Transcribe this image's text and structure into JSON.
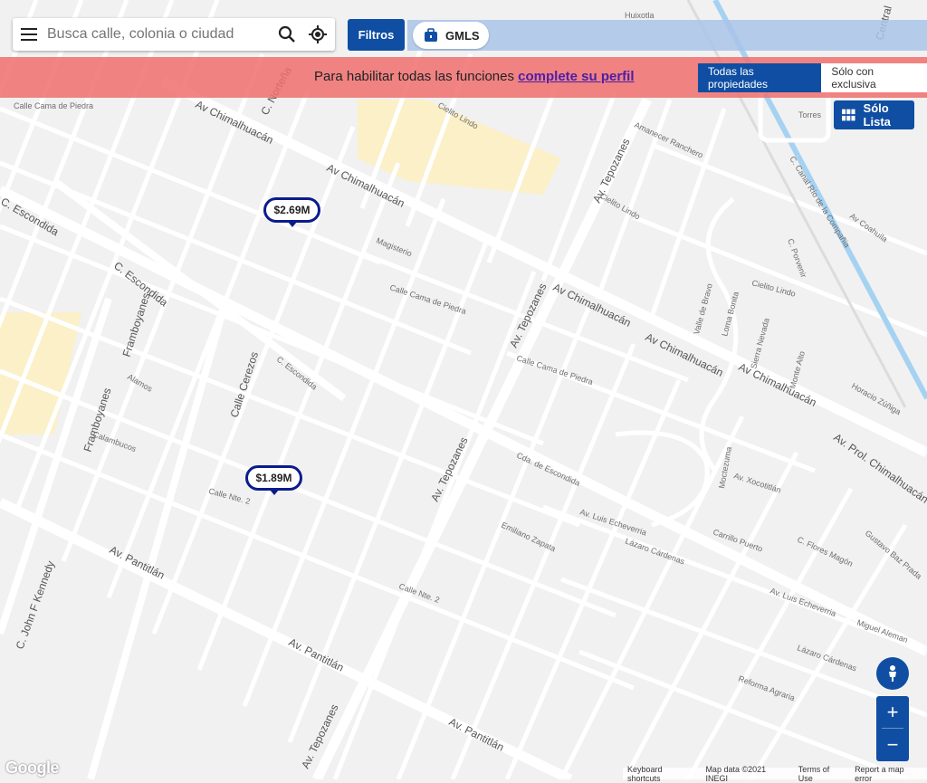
{
  "search": {
    "placeholder": "Busca calle, colonia o ciudad"
  },
  "toolbar": {
    "filters_label": "Filtros",
    "gmls_label": "GMLS"
  },
  "banner": {
    "text": "Para habilitar todas las funciones",
    "link": "complete su perfil"
  },
  "segmented": {
    "all_label": "Todas las propiedades",
    "exclusive_label": "Sólo con exclusiva"
  },
  "list_button": {
    "label": "Sólo Lista"
  },
  "listings": [
    {
      "price": "$2.69M"
    },
    {
      "price": "$1.89M"
    }
  ],
  "streets": {
    "av_chimalhuacan": "Av Chimalhuacán",
    "av_pantitlan": "Av. Pantitlán",
    "av_tepozanes": "Av. Tepozanes",
    "c_escondida": "C. Escondida",
    "framboyanes": "Framboyanes",
    "c_cerezos": "Calle Cerezos",
    "calle_cama_de_piedra": "Calle Cama de Piedra",
    "av_prol_chimalhuacan": "Av. Prol. Chimalhuacán",
    "calle_nte_2": "Calle Nte. 2",
    "c_norteña": "C. Norteña",
    "cielito_lindo": "Cielito Lindo",
    "magisterio": "Magisterio",
    "calambucos": "Calambucos",
    "alamos": "Alamos",
    "av_luis_echeverria": "Av. Luis Echeverria",
    "lazaro_cardenas": "Lázaro Cárdenas",
    "carrillo_puerto": "Carrillo Puerto",
    "c_john_f_kennedy": "C. John F Kennedy",
    "torres": "Torres",
    "central": "Central",
    "huixotla": "Huixotla",
    "emiliano_zapata": "Emiliano Zapata",
    "monte_alto": "Monte Alto",
    "sierra_nevada": "Sierra Nevada",
    "loma_bonita": "Loma Bonita",
    "valle_de_bravo": "Valle de Bravo",
    "c_porvenir": "C. Porvenir",
    "canal_rio_compania": "C. Canal Río de la Compañia",
    "av_coahuila": "Av Coahuila",
    "horacio_zuñiga": "Horacio Zúñiga",
    "miguel_aleman": "Miguel Aleman",
    "reforma_agraria": "Reforma Agraria",
    "moctezuma": "Moctezuma",
    "av_xocotitlan": "Av. Xocotitlán",
    "cda_escondida": "Cda. de Escondida",
    "amanecer_ranchero": "Amanecer Ranchero",
    "gustavo_baz_prada": "Gustavo Baz Prada",
    "c_flores_magon": "C. Flores Magón"
  },
  "map_controls": {
    "zoom_in": "+",
    "zoom_out": "−"
  },
  "attribution": {
    "logo": "Google",
    "keyboard": "Keyboard shortcuts",
    "map_data": "Map data ©2021 INEGI",
    "terms": "Terms of Use",
    "report": "Report a map error"
  },
  "colors": {
    "primary": "#0f4ea3",
    "banner": "#f06e6e",
    "pin_border": "#0a1c8c",
    "canal": "#a6d2f2"
  }
}
